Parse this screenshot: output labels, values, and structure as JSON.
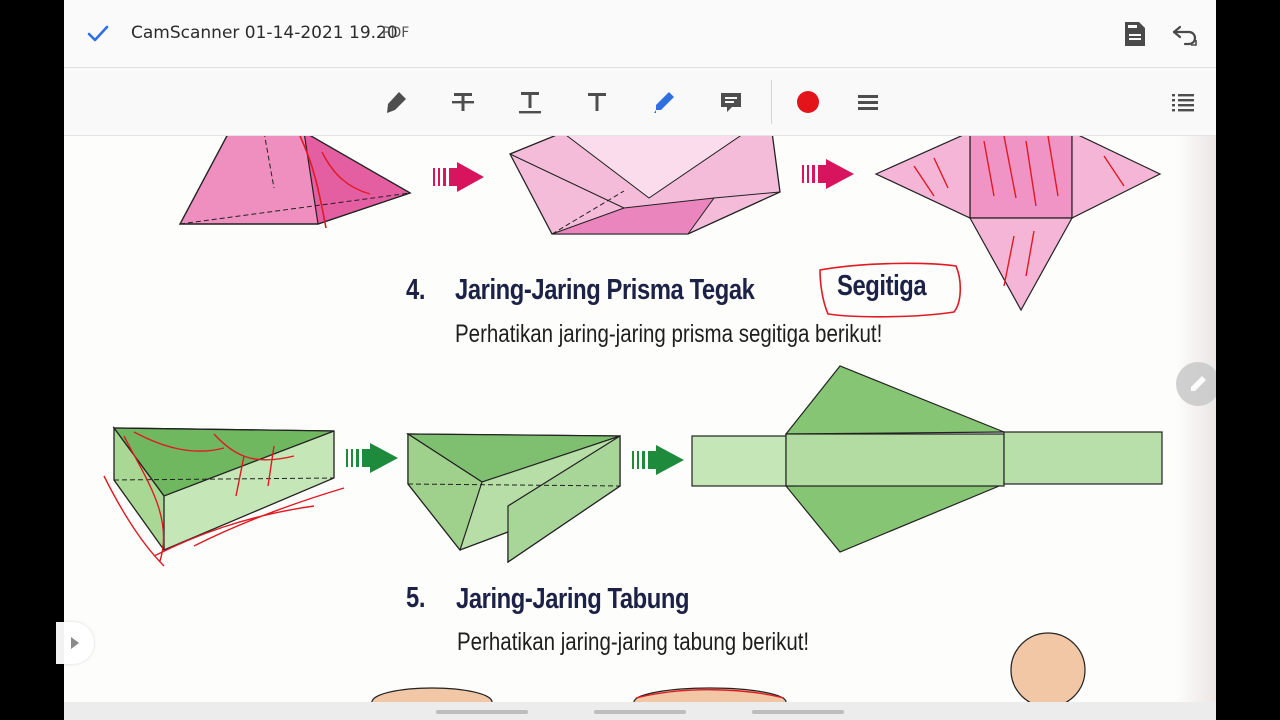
{
  "header": {
    "title": "CamScanner 01-14-2021 19.20",
    "file_type": "PDF",
    "icons": [
      "checkmark-icon",
      "save-icon",
      "undo-icon"
    ]
  },
  "toolbar": {
    "tools": [
      "highlighter-icon",
      "strikethrough-icon",
      "underline-icon",
      "text-icon",
      "pen-icon",
      "comment-icon"
    ],
    "active_tool": "pen-icon",
    "active_color": "#e4141b",
    "menu_icon": "menu-lines-icon",
    "outline_icon": "outline-list-icon"
  },
  "content": {
    "section4": {
      "number": "4.",
      "title_main": "Jaring-Jaring Prisma Tegak",
      "title_highlight": "Segitiga",
      "subtitle": "Perhatikan jaring-jaring prisma segitiga berikut!"
    },
    "section5": {
      "number": "5.",
      "title": "Jaring-Jaring Tabung",
      "subtitle": "Perhatikan jaring-jaring tabung berikut!"
    }
  },
  "colors": {
    "pink_face": "#ee9fcc",
    "pink_dark": "#d85aa0",
    "green_face": "#8ccb7e",
    "green_light": "#bfe3b0",
    "arrow_pink": "#d8145e",
    "arrow_green": "#1e8a3c",
    "annotation_red": "#e11a22",
    "orange": "#f2c7a6"
  }
}
